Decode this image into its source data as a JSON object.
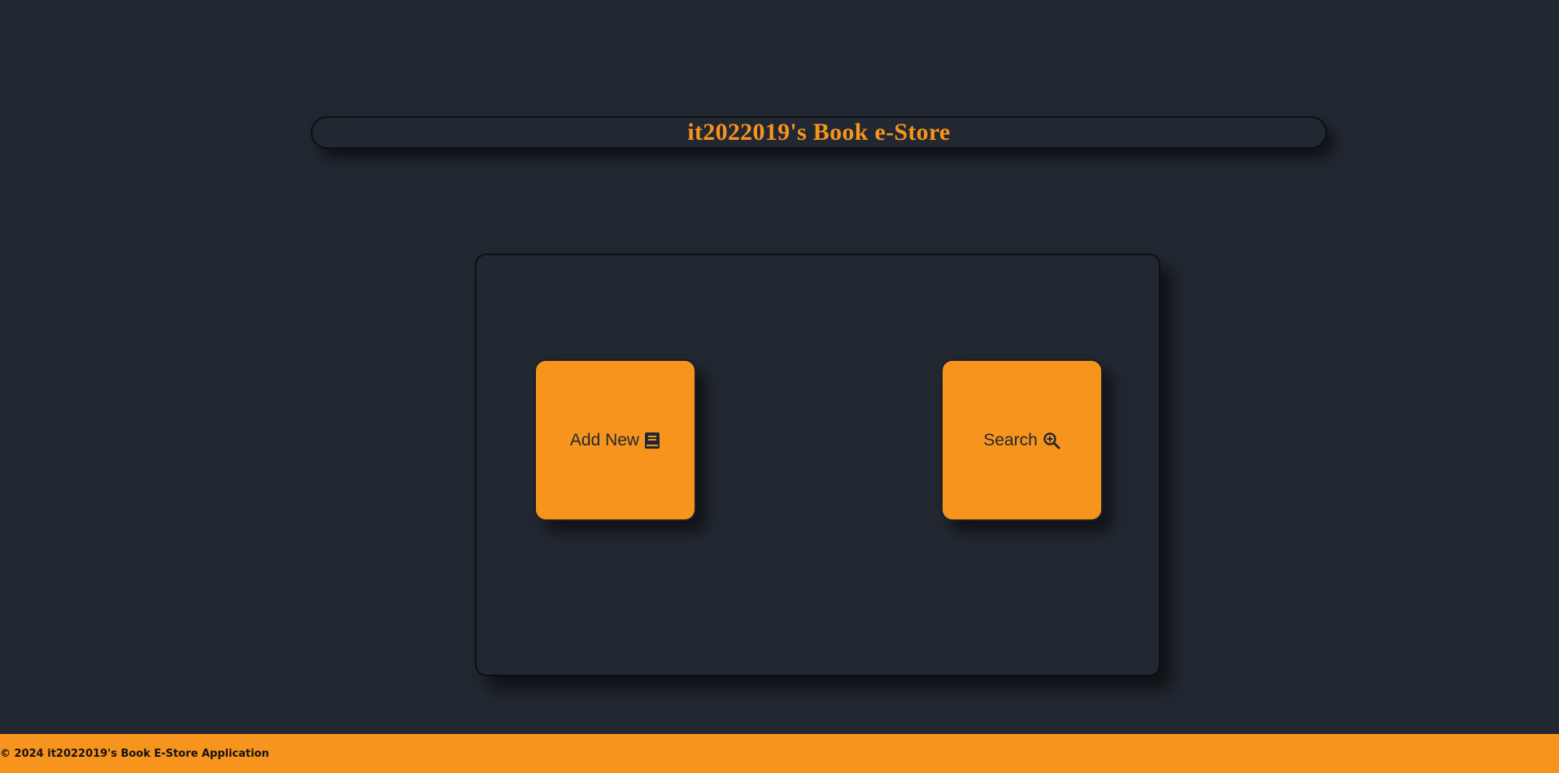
{
  "header": {
    "title": "it2022019's Book e-Store"
  },
  "actions": {
    "add_new": {
      "label": "Add New",
      "icon": "book-icon"
    },
    "search": {
      "label": "Search",
      "icon": "magnifier-plus-icon"
    }
  },
  "footer": {
    "text": "© 2024 it2022019's Book E-Store Application"
  },
  "colors": {
    "background": "#222831",
    "accent": "#f7941d",
    "text_dark": "#222831"
  }
}
